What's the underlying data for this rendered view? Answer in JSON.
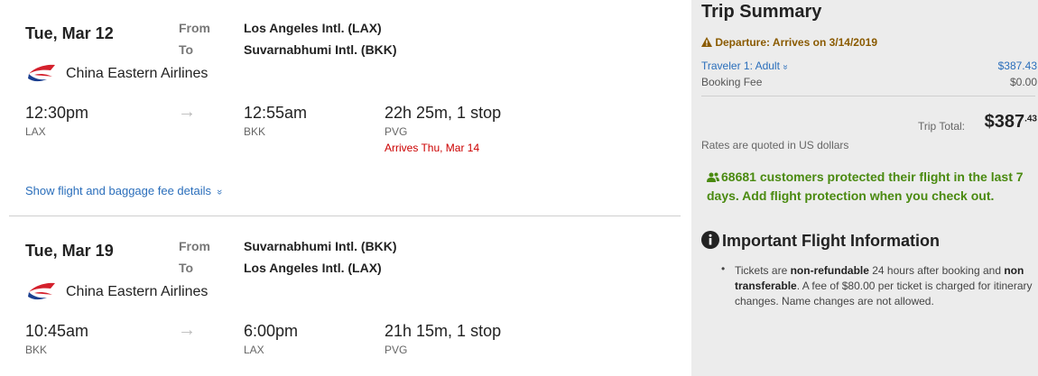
{
  "flights": [
    {
      "date": "Tue, Mar 12",
      "from_label": "From",
      "to_label": "To",
      "from_airport": "Los Angeles Intl. (LAX)",
      "to_airport": "Suvarnabhumi Intl. (BKK)",
      "airline": "China Eastern Airlines",
      "depart_time": "12:30pm",
      "depart_code": "LAX",
      "arrive_time": "12:55am",
      "arrive_code": "BKK",
      "duration": "22h 25m, 1 stop",
      "stop_code": "PVG",
      "arrives_note": "Arrives Thu, Mar 14",
      "details_link": "Show flight and baggage fee details"
    },
    {
      "date": "Tue, Mar 19",
      "from_label": "From",
      "to_label": "To",
      "from_airport": "Suvarnabhumi Intl. (BKK)",
      "to_airport": "Los Angeles Intl. (LAX)",
      "airline": "China Eastern Airlines",
      "depart_time": "10:45am",
      "depart_code": "BKK",
      "arrive_time": "6:00pm",
      "arrive_code": "LAX",
      "duration": "21h 15m, 1 stop",
      "stop_code": "PVG"
    }
  ],
  "arrow_glyph": "→",
  "chevron_glyph": "»",
  "summary": {
    "title": "Trip Summary",
    "warning": "Departure: Arrives on 3/14/2019",
    "traveler_label": "Traveler 1: Adult",
    "traveler_price": "$387.43",
    "booking_fee_label": "Booking Fee",
    "booking_fee_value": "$0.00",
    "trip_total_label": "Trip Total:",
    "trip_total_dollars": "$387",
    "trip_total_cents": ".43",
    "rates_note": "Rates are quoted in US dollars",
    "protection_text": "68681 customers protected their flight in the last 7 days. Add flight protection when you check out.",
    "important_title": "Important Flight Information",
    "bullet": {
      "t1": "Tickets are ",
      "b1": "non-refundable",
      "t2": " 24 hours after booking and ",
      "b2": "non transferable",
      "t3": ". A fee of $80.00 per ticket is charged for itinerary changes. Name changes are not allowed."
    }
  },
  "colors": {
    "link": "#2a6ebb",
    "warning": "#8a5a00",
    "alert_red": "#cc0000",
    "protection_green": "#4a8a10",
    "summary_bg": "#ececec"
  },
  "icons": {
    "airline_logo": "china-eastern-logo",
    "warning": "warning-triangle-icon",
    "users": "users-icon",
    "info": "info-circle-icon"
  }
}
